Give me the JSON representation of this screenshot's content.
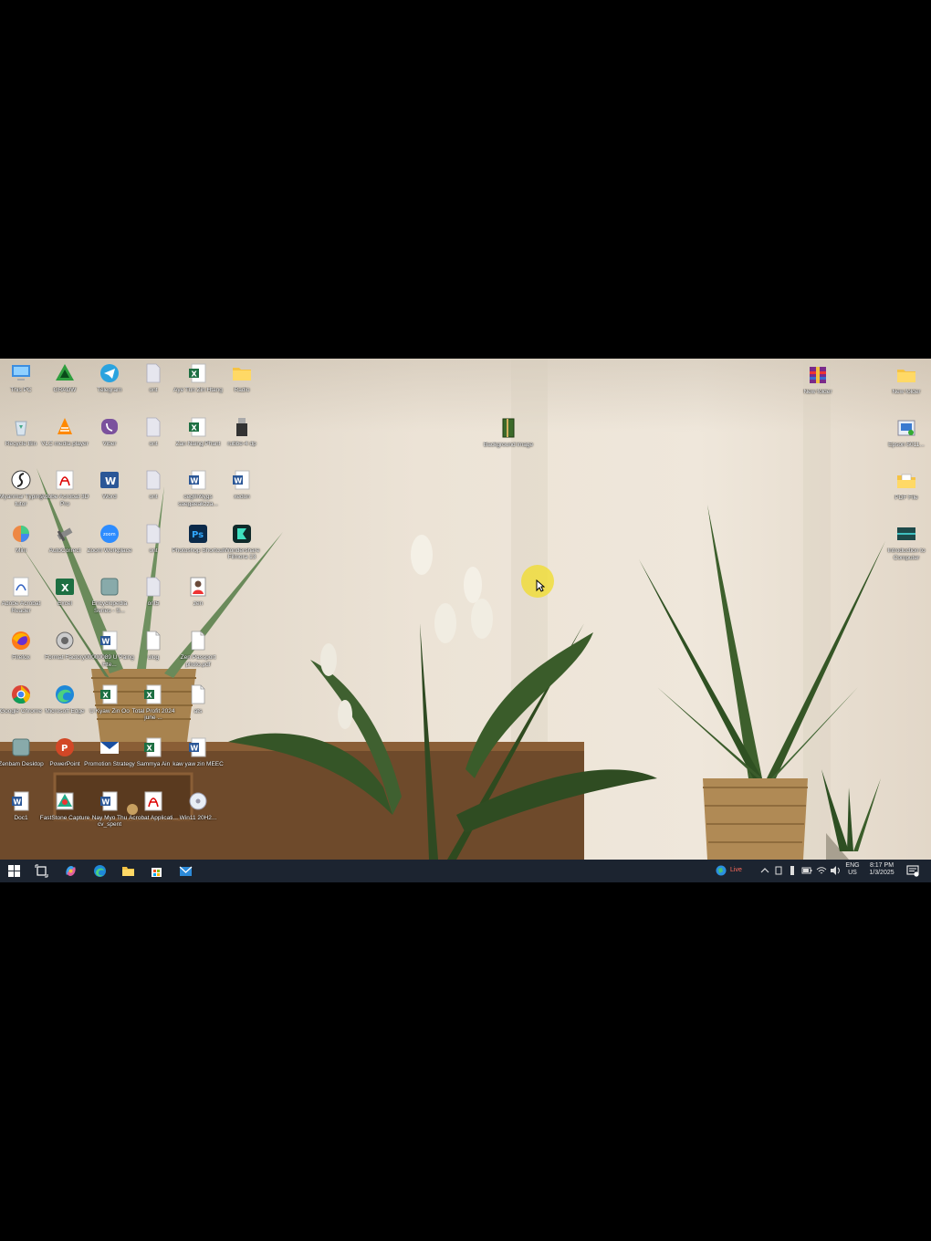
{
  "desktop": {
    "icons_left": [
      {
        "label": "This PC",
        "glyph": "pc-icon"
      },
      {
        "label": "Recycle Bin",
        "glyph": "recycle-bin-icon"
      },
      {
        "label": "Myanmar Typing tutor",
        "glyph": "flash-icon"
      },
      {
        "label": "Mini",
        "glyph": "pie-app-icon"
      },
      {
        "label": "Adobe Acrobat Reader",
        "glyph": "acrobat-reader-icon"
      },
      {
        "label": "Firefox",
        "glyph": "firefox-icon"
      },
      {
        "label": "Google Chrome",
        "glyph": "chrome-icon"
      },
      {
        "label": "Zenbam Desktop",
        "glyph": "app-icon"
      },
      {
        "label": "Doc1",
        "glyph": "word-doc-icon"
      },
      {
        "label": "GRADW",
        "glyph": "triangle-app-icon"
      },
      {
        "label": "VLC media player",
        "glyph": "vlc-icon"
      },
      {
        "label": "Adobe Acrobat 3D Pro",
        "glyph": "acrobat-icon"
      },
      {
        "label": "AutoCorrect",
        "glyph": "tool-icon"
      },
      {
        "label": "Excel",
        "glyph": "excel-icon"
      },
      {
        "label": "Format Factory",
        "glyph": "format-factory-icon"
      },
      {
        "label": "Microsoft Edge",
        "glyph": "edge-icon"
      },
      {
        "label": "PowerPoint",
        "glyph": "powerpoint-icon"
      },
      {
        "label": "FastStone Capture",
        "glyph": "faststone-icon"
      },
      {
        "label": "Telegram",
        "glyph": "telegram-icon"
      },
      {
        "label": "Viber",
        "glyph": "viber-icon"
      },
      {
        "label": "Word",
        "glyph": "word-icon"
      },
      {
        "label": "Zoom Workplace",
        "glyph": "zoom-icon"
      },
      {
        "label": "Encyclopedia Series - S...",
        "glyph": "app-icon"
      },
      {
        "label": "00000089 U Paing Hte...",
        "glyph": "word-doc-icon"
      },
      {
        "label": "U Kyaw Zin Oo",
        "glyph": "excel-doc-icon"
      },
      {
        "label": "Promotion Strategy",
        "glyph": "promo-icon"
      },
      {
        "label": "Nay Myo Thu cv_spent",
        "glyph": "word-doc-icon"
      },
      {
        "label": "ont",
        "glyph": "file-icon"
      },
      {
        "label": "ont",
        "glyph": "file-icon"
      },
      {
        "label": "ont",
        "glyph": "file-icon"
      },
      {
        "label": "ont",
        "glyph": "file-icon"
      },
      {
        "label": "ont5",
        "glyph": "file-icon"
      },
      {
        "label": "ulog",
        "glyph": "blank-file-icon"
      },
      {
        "label": "Total Profit 2024 june ...",
        "glyph": "excel-doc-icon"
      },
      {
        "label": "Sammya Ain",
        "glyph": "excel-doc-icon"
      },
      {
        "label": "Acrobat Applicati...",
        "glyph": "acrobat-icon"
      },
      {
        "label": "Aye Tun Zin Htang",
        "glyph": "excel-doc-icon"
      },
      {
        "label": "Zan Naing Phant",
        "glyph": "excel-doc-icon"
      },
      {
        "label": "ceg0n9ygs saegaeakzza...",
        "glyph": "word-doc-icon"
      },
      {
        "label": "Photoshop Shortcut",
        "glyph": "photoshop-icon"
      },
      {
        "label": "zen",
        "glyph": "photo-icon"
      },
      {
        "label": "Zen Passport photo.pdf",
        "glyph": "blank-file-icon"
      },
      {
        "label": "ats",
        "glyph": "blank-file-icon"
      },
      {
        "label": "kaw yaw zin MEEC",
        "glyph": "word-doc-icon"
      },
      {
        "label": "Win11 20H2...",
        "glyph": "disc-icon"
      },
      {
        "label": "Radio",
        "glyph": "folder-icon"
      },
      {
        "label": "rubbe-4 dp",
        "glyph": "usb-icon"
      },
      {
        "label": "xedon",
        "glyph": "word-doc-icon"
      },
      {
        "label": "Wondershare Filmora 13",
        "glyph": "filmora-icon"
      }
    ],
    "icons_middle": [
      {
        "label": "Background image",
        "glyph": "book-icon"
      }
    ],
    "icons_right": [
      {
        "label": "New folder",
        "glyph": "winrar-icon"
      },
      {
        "label": "New folder",
        "glyph": "folder-icon"
      },
      {
        "label": "Epson 5011...",
        "glyph": "epson-icon"
      },
      {
        "label": "PDF File",
        "glyph": "folder-doc-icon"
      },
      {
        "label": "Introduction to Computer",
        "glyph": "video-icon"
      }
    ]
  },
  "taskbar": {
    "pinned": [
      "windows-start-icon",
      "task-view-icon",
      "copilot-icon",
      "edge-icon",
      "file-explorer-icon",
      "store-icon",
      "mail-icon"
    ],
    "weather_label": "Live",
    "language": "ENG",
    "region": "US",
    "time": "8:17 PM",
    "date": "1/3/2025"
  }
}
